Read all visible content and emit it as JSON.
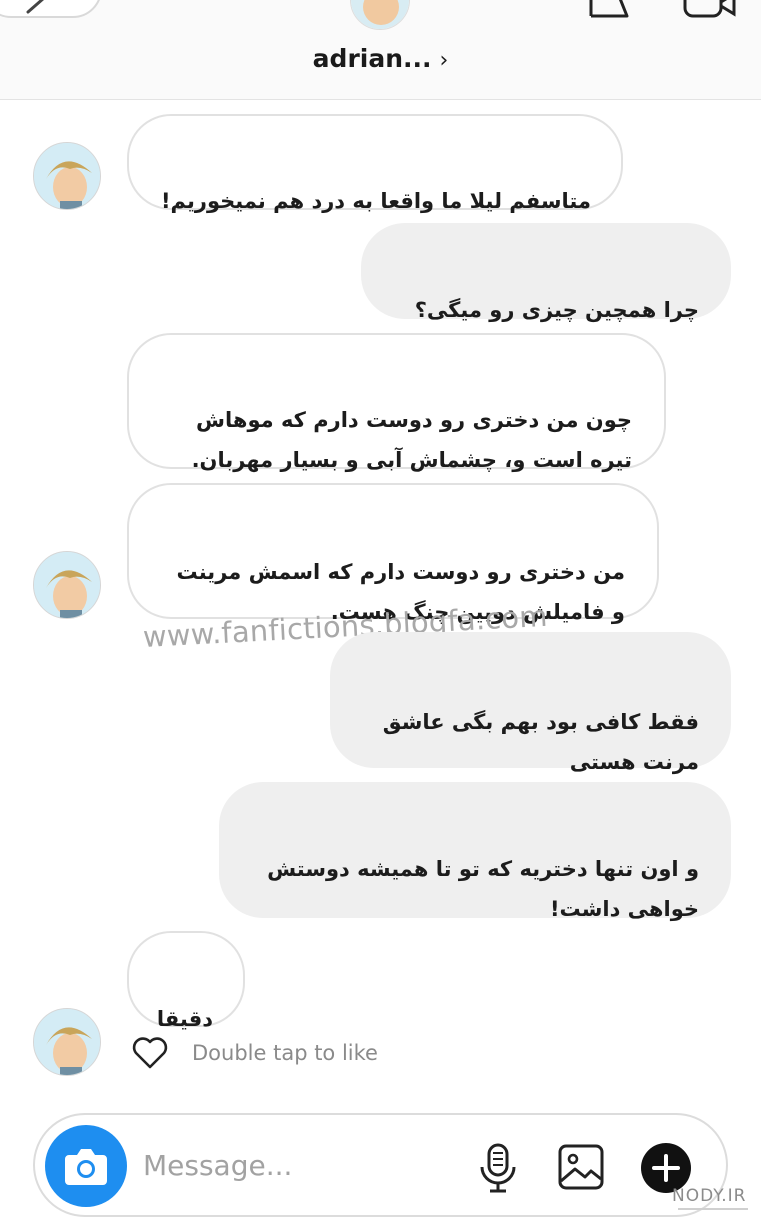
{
  "header": {
    "title": "adrian...",
    "chevron": "›",
    "back_icon": "chevron-left-icon",
    "avatar_icon": "avatar",
    "flag_icon": "flag-icon",
    "video_icon": "video-camera-icon"
  },
  "messages": [
    {
      "side": "incoming",
      "text": "متاسفم لیلا ما واقعا به درد هم نمیخوریم!"
    },
    {
      "side": "outgoing",
      "text": "چرا همچین چیزی رو میگی؟"
    },
    {
      "side": "incoming",
      "text": "چون من دختری رو دوست دارم که موهاش\nتیره است و، چشماش آبی و  بسیار مهربان."
    },
    {
      "side": "incoming",
      "text": "من دختری رو دوست دارم که اسمش مرینت\nو فامیلش دوپین چنگ هست."
    },
    {
      "side": "outgoing",
      "text": "فقط کافی بود بهم بگی عاشق\nمرنت هستی"
    },
    {
      "side": "outgoing",
      "text": "و اون تنها دختریه که تو تا همیشه دوستش\nخواهی داشت!"
    },
    {
      "side": "incoming",
      "text": "دقیقا"
    }
  ],
  "watermark": "www.fanfictions.blogfa.com",
  "like_hint": "Double tap to like",
  "composer": {
    "placeholder": "Message...",
    "camera_icon": "camera-icon",
    "mic_icon": "microphone-icon",
    "gallery_icon": "image-icon",
    "plus_icon": "plus-icon"
  },
  "corner_logo": "NODY.IR",
  "colors": {
    "accent": "#1e8ef0",
    "outgoing_bubble": "#efefef",
    "incoming_border": "#e1e1e1"
  }
}
